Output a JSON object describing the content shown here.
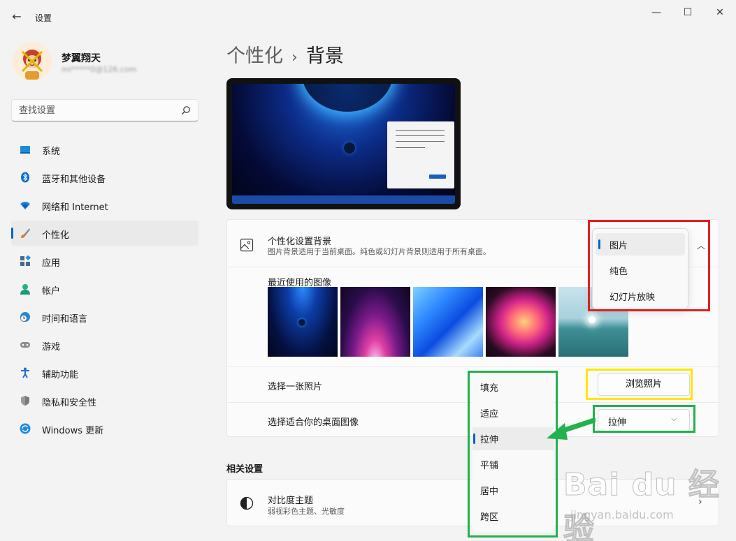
{
  "window": {
    "title": "设置",
    "back_glyph": "←",
    "minimize_glyph": "—",
    "maximize_glyph": "☐",
    "close_glyph": "✕"
  },
  "profile": {
    "name": "梦翼翔天",
    "email": "mi*****0@126.com"
  },
  "search": {
    "placeholder": "查找设置",
    "icon": "search-icon"
  },
  "sidebar": {
    "items": [
      {
        "label": "系统",
        "icon": "system-icon",
        "active": false
      },
      {
        "label": "蓝牙和其他设备",
        "icon": "bluetooth-icon",
        "active": false
      },
      {
        "label": "网络和 Internet",
        "icon": "wifi-icon",
        "active": false
      },
      {
        "label": "个性化",
        "icon": "brush-icon",
        "active": true
      },
      {
        "label": "应用",
        "icon": "apps-icon",
        "active": false
      },
      {
        "label": "帐户",
        "icon": "account-icon",
        "active": false
      },
      {
        "label": "时间和语言",
        "icon": "clock-globe-icon",
        "active": false
      },
      {
        "label": "游戏",
        "icon": "gamepad-icon",
        "active": false
      },
      {
        "label": "辅助功能",
        "icon": "accessibility-icon",
        "active": false
      },
      {
        "label": "隐私和安全性",
        "icon": "shield-icon",
        "active": false
      },
      {
        "label": "Windows 更新",
        "icon": "update-icon",
        "active": false
      }
    ]
  },
  "header": {
    "parent": "个性化",
    "separator": "›",
    "current": "背景"
  },
  "background_card": {
    "title": "个性化设置背景",
    "description": "图片背景适用于当前桌面。纯色或幻灯片背景则适用于所有桌面。",
    "collapse_glyph": "︿",
    "recent_label": "最近使用的图像",
    "recent_images": [
      "wallpaper-blue-planet",
      "wallpaper-pink-glow",
      "wallpaper-blue-bloom",
      "wallpaper-colorful-ribbons",
      "wallpaper-lake-sunrise"
    ],
    "choose_photo_label": "选择一张照片",
    "browse_button": "浏览照片",
    "fit_label": "选择适合你的桌面图像",
    "fit_value": "拉伸",
    "fit_chevron": "⌵"
  },
  "background_type_flyout": {
    "options": [
      "图片",
      "纯色",
      "幻灯片放映"
    ],
    "selected": "图片"
  },
  "fit_flyout": {
    "options": [
      "填充",
      "适应",
      "拉伸",
      "平铺",
      "居中",
      "跨区"
    ],
    "selected": "拉伸"
  },
  "related": {
    "title": "相关设置",
    "contrast_title": "对比度主题",
    "contrast_desc": "弱视彩色主题、光敏度",
    "chevron": "›"
  },
  "watermark": {
    "text": "Bai du 经验",
    "sub": "jingyan.baidu.com"
  },
  "colors": {
    "accent": "#0067c0",
    "annotation_red": "#e02020",
    "annotation_yellow": "#ffe600",
    "annotation_green": "#22b14c"
  }
}
